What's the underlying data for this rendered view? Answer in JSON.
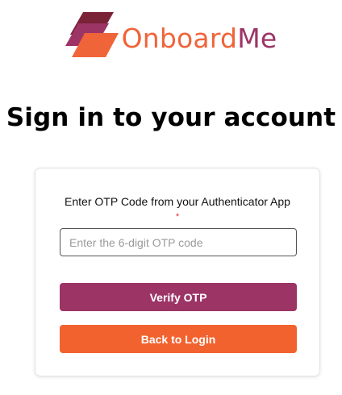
{
  "brand": {
    "name_part1": "Onboard",
    "name_part2": "Me",
    "color_primary": "#f0643a",
    "color_secondary": "#9c3466"
  },
  "heading": "Sign in to your account",
  "otp_form": {
    "label": "Enter OTP Code from your Authenticator App",
    "required_marker": "*",
    "input_placeholder": "Enter the 6-digit OTP code",
    "input_value": "",
    "verify_button": "Verify OTP",
    "back_button": "Back to Login"
  },
  "colors": {
    "verify_button": "#9c3466",
    "back_button": "#f2622e",
    "required": "#e03030"
  }
}
